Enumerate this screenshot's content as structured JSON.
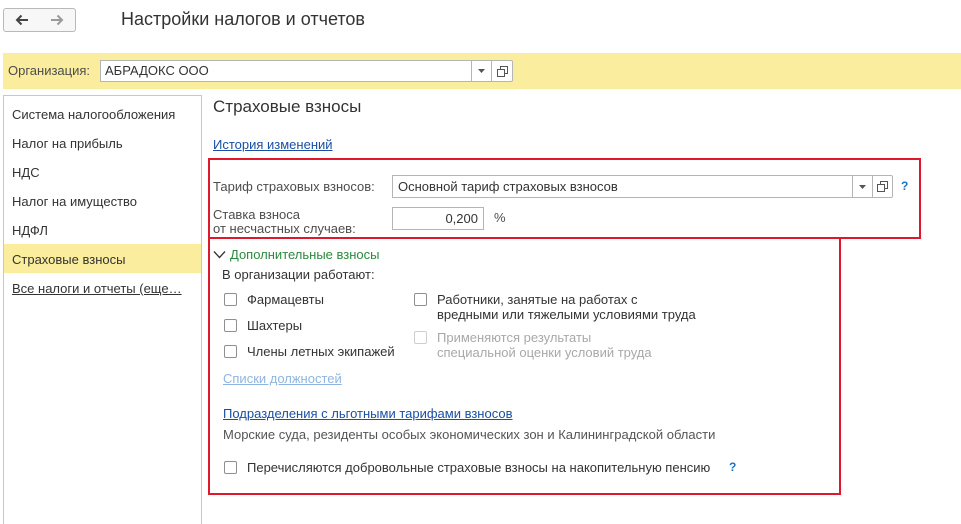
{
  "header": {
    "title": "Настройки налогов и отчетов",
    "back_icon": "arrow-left-icon",
    "forward_icon": "arrow-right-icon"
  },
  "organization": {
    "label": "Организация:",
    "value": "АБРАДОКС ООО"
  },
  "sidebar": {
    "items": [
      {
        "label": "Система налогообложения",
        "active": false
      },
      {
        "label": "Налог на прибыль",
        "active": false
      },
      {
        "label": "НДС",
        "active": false
      },
      {
        "label": "Налог на имущество",
        "active": false
      },
      {
        "label": "НДФЛ",
        "active": false
      },
      {
        "label": "Страховые взносы",
        "active": true
      },
      {
        "label": "Все налоги и отчеты (еще…",
        "active": false
      }
    ]
  },
  "main": {
    "section_title": "Страховые взносы",
    "history_link": "История изменений",
    "tariff_label": "Тариф страховых взносов:",
    "tariff_value": "Основной тариф страховых взносов",
    "rate_label_line1": "Ставка взноса",
    "rate_label_line2": "от несчастных случаев:",
    "rate_value": "0,200",
    "rate_unit": "%",
    "help_mark": "?",
    "additional": {
      "header": "Дополнительные взносы",
      "employees_label": "В организации работают:",
      "checkboxes_left": [
        "Фармацевты",
        "Шахтеры",
        "Члены летных экипажей"
      ],
      "harmful_line1": "Работники, занятые на работах с",
      "harmful_line2": "вредными или тяжелыми условиями труда",
      "assessment_line1": "Применяются результаты",
      "assessment_line2": "специальной оценки условий труда",
      "positions_link": "Списки должностей",
      "divisions_link": "Подразделения с льготными тарифами взносов",
      "divisions_note": "Морские суда, резиденты особых экономических зон и Калининградской области",
      "voluntary_label": "Перечисляются добровольные страховые взносы на накопительную пенсию"
    }
  },
  "colors": {
    "accent_yellow": "#fbed9e",
    "highlight_red": "#e0182d",
    "link_blue": "#1a4fa3",
    "group_green": "#2b8a3e",
    "help_blue": "#1a75c4"
  }
}
